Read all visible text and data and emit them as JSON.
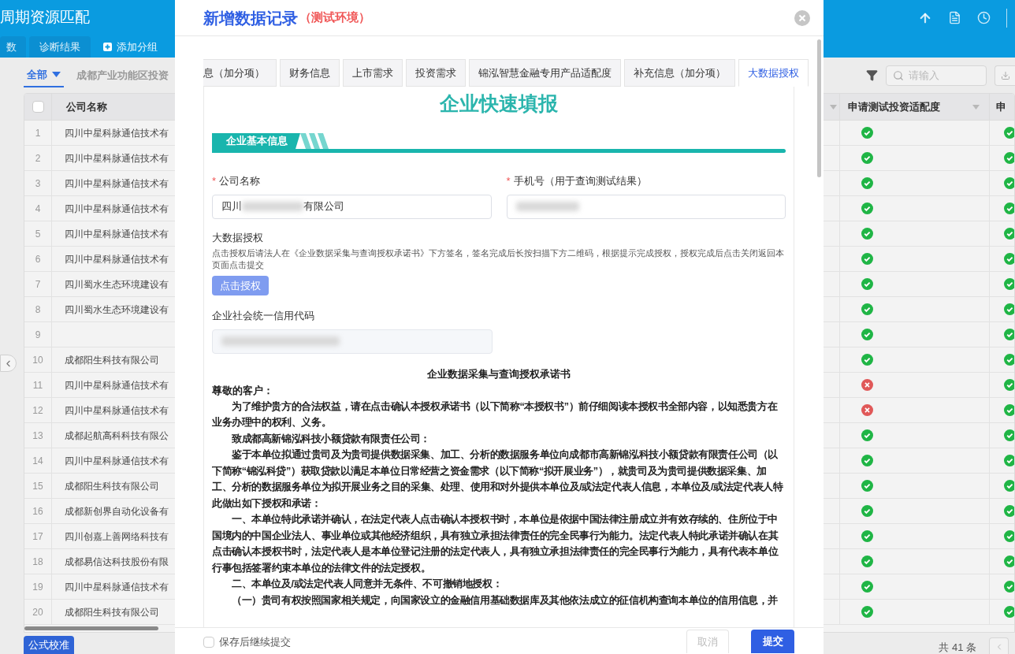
{
  "app": {
    "title": "周期资源匹配",
    "tabs": [
      {
        "label": "数"
      },
      {
        "label": "诊断结果"
      }
    ],
    "add_group": "添加分组"
  },
  "toolbar": {
    "filters": [
      {
        "label": "全部",
        "selected": true
      },
      {
        "label": "成都产业功能区投资",
        "selected": false
      }
    ],
    "search": {
      "placeholder": "请输入"
    }
  },
  "table": {
    "select_all": {
      "checked": false
    },
    "columns": [
      "公司名称",
      "申请测试投资适配度",
      "申"
    ],
    "rows": [
      {
        "index": "1",
        "name": "四川中星科脉通信技术有",
        "col_a": true,
        "col_b": true
      },
      {
        "index": "2",
        "name": "四川中星科脉通信技术有",
        "col_a": true,
        "col_b": true
      },
      {
        "index": "3",
        "name": "四川中星科脉通信技术有",
        "col_a": true,
        "col_b": true
      },
      {
        "index": "4",
        "name": "四川中星科脉通信技术有",
        "col_a": true,
        "col_b": true
      },
      {
        "index": "5",
        "name": "四川中星科脉通信技术有",
        "col_a": true,
        "col_b": true
      },
      {
        "index": "6",
        "name": "四川中星科脉通信技术有",
        "col_a": true,
        "col_b": true
      },
      {
        "index": "7",
        "name": "四川蜀水生态环境建设有",
        "col_a": true,
        "col_b": true
      },
      {
        "index": "8",
        "name": "四川蜀水生态环境建设有",
        "col_a": true,
        "col_b": true
      },
      {
        "index": "9",
        "col_a": true,
        "col_b": true
      },
      {
        "index": "10",
        "name": "成都阳生科技有限公司",
        "col_a": true,
        "col_b": true
      },
      {
        "index": "11",
        "name": "四川中星科脉通信技术有",
        "col_a": false,
        "col_b": true
      },
      {
        "index": "12",
        "name": "四川中星科脉通信技术有",
        "col_a": false,
        "col_b": true
      },
      {
        "index": "13",
        "name": "成都起航高科科技有限公",
        "col_a": true,
        "col_b": true
      },
      {
        "index": "14",
        "name": "四川中星科脉通信技术有",
        "col_a": true,
        "col_b": true
      },
      {
        "index": "15",
        "name": "成都阳生科技有限公司",
        "col_a": true,
        "col_b": true
      },
      {
        "index": "16",
        "name": "成都新创界自动化设备有",
        "col_a": true,
        "col_b": true
      },
      {
        "index": "17",
        "name": "四川创嘉上善网络科技有",
        "col_a": true,
        "col_b": true
      },
      {
        "index": "18",
        "name": "成都易信达科技股份有限",
        "col_a": true,
        "col_b": true
      },
      {
        "index": "19",
        "name": "四川中星科脉通信技术有",
        "col_a": true,
        "col_b": true
      },
      {
        "index": "20",
        "name": "成都阳生科技有限公司",
        "col_a": true,
        "col_b": true
      }
    ]
  },
  "footer": {
    "button": "公式校准",
    "total": "共 41 条"
  },
  "dialog": {
    "title": "新增数据记录",
    "env": "（测试环境）",
    "tabs": [
      {
        "label": "息（加分项）",
        "selected": false
      },
      {
        "label": "财务信息",
        "selected": false
      },
      {
        "label": "上市需求",
        "selected": false
      },
      {
        "label": "投资需求",
        "selected": false
      },
      {
        "label": "锦泓智慧金融专用产品适配度",
        "selected": false
      },
      {
        "label": "补充信息（加分项）",
        "selected": false
      },
      {
        "label": "大数据授权",
        "selected": true
      }
    ],
    "heading": "企业快速填报",
    "section": "企业基本信息",
    "fields": [
      {
        "label": "公司名称",
        "marker": "*",
        "redacted": true,
        "value_parts": [
          "四川",
          "有限公司"
        ]
      },
      {
        "label": "手机号（用于查询测试结果）",
        "marker": "*",
        "redacted": true
      }
    ],
    "authorization": {
      "label": "大数据授权",
      "description": "点击授权后请法人在《企业数据采集与查询授权承诺书》下方签名，签名完成后长按扫描下方二维码，根据提示完成授权，授权完成后点击关闭返回本页面点击提交",
      "button": "点击授权"
    },
    "credit_code": {
      "label": "企业社会统一信用代码",
      "redacted": true
    },
    "document": {
      "title": "企业数据采集与查询授权承诺书",
      "greeting": "尊敬的客户：",
      "paragraphs": [
        "为了维护贵方的合法权益，请在点击确认本授权承诺书（以下简称“本授权书”）前仔细阅读本授权书全部内容，以知悉贵方在业务办理中的权利、义务。",
        "致成都高新锦泓科技小额贷款有限责任公司：",
        "鉴于本单位拟通过贵司及为贵司提供数据采集、加工、分析的数据服务单位向成都市高新锦泓科技小额贷款有限责任公司（以下简称“锦泓科贷”）获取贷款以满足本单位日常经营之资金需求（以下简称“拟开展业务”），就贵司及为贵司提供数据采集、加工、分析的数据服务单位为拟开展业务之目的采集、处理、使用和对外提供本单位及/或法定代表人信息，本单位及/或法定代表人特此做出如下授权和承诺：",
        "一、本单位特此承诺并确认，在法定代表人点击确认本授权书时，本单位是依据中国法律注册成立并有效存续的、住所位于中国境内的中国企业法人、事业单位或其他经济组织，具有独立承担法律责任的完全民事行为能力。法定代表人特此承诺并确认在其点击确认本授权书时，法定代表人是本单位登记注册的法定代表人，具有独立承担法律责任的完全民事行为能力，具有代表本单位行事包括签署约束本单位的法律文件的法定授权。",
        "二、本单位及/或法定代表人同意并无条件、不可撤销地授权：",
        "（一）贵司有权按照国家相关规定，向国家设立的金融信用基础数据库及其他依法成立的征信机构查询本单位的信用信息，并"
      ]
    },
    "footer": {
      "checkbox": {
        "label": "保存后继续提交",
        "checked": false
      },
      "cancel": {
        "label": "取消",
        "disabled": true
      },
      "submit": "提交"
    }
  }
}
